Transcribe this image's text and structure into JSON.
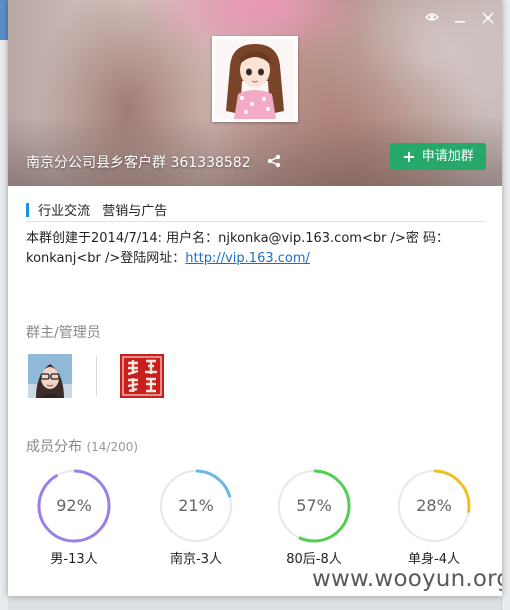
{
  "window_controls": {
    "icon_names": [
      "settings-icon",
      "minimize-icon",
      "close-icon"
    ]
  },
  "group": {
    "name": "南京分公司县乡客户群 361338582",
    "join_label": "申请加群"
  },
  "tags": [
    "行业交流",
    "营销与广告"
  ],
  "description": {
    "text_before_link": "本群创建于2014/7/14:  用户名：njkonka@vip.163.com<br />密  码：konkanj<br />登陆网址：",
    "link_text": "http://vip.163.com/"
  },
  "admins": {
    "label": "群主/管理员"
  },
  "members": {
    "label": "成员分布",
    "count": "(14/200)",
    "stats": [
      {
        "pct_label": "92%",
        "value": 0.92,
        "label": "男-13人",
        "color": "#9b7fe6"
      },
      {
        "pct_label": "21%",
        "value": 0.21,
        "label": "南京-3人",
        "color": "#6ab8e8"
      },
      {
        "pct_label": "57%",
        "value": 0.57,
        "label": "80后-8人",
        "color": "#4fd04f"
      },
      {
        "pct_label": "28%",
        "value": 0.28,
        "label": "单身-4人",
        "color": "#f0c020"
      }
    ]
  },
  "watermark": "www.wooyun.org",
  "colors": {
    "join_button": "#25a86a",
    "link": "#1a6fc2",
    "tag_accent": "#1f8ee8",
    "ring_track": "#e4e9ee"
  }
}
